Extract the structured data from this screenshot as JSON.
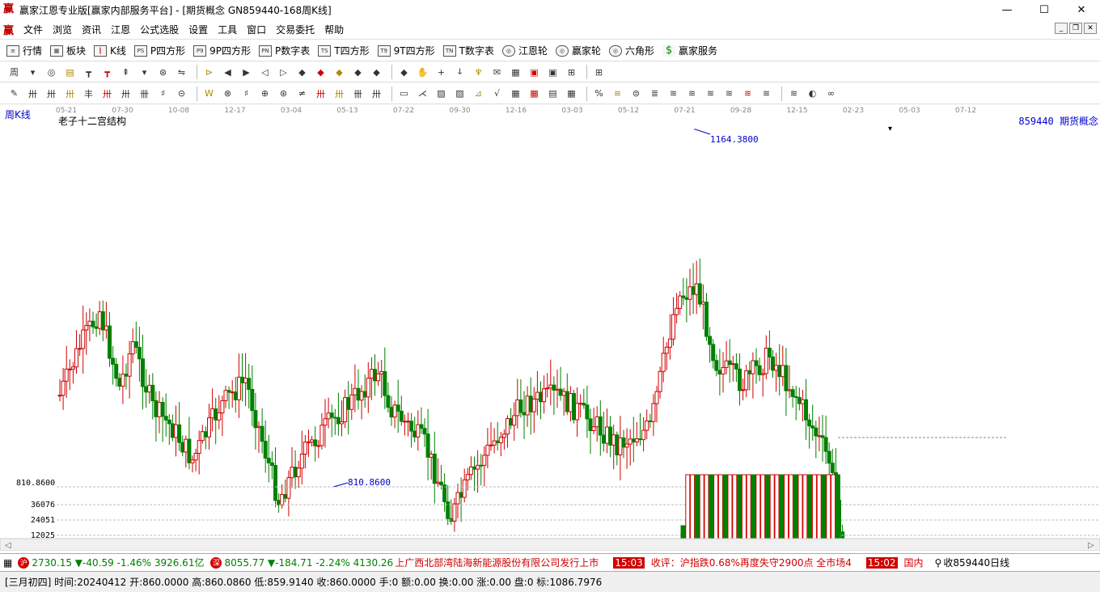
{
  "window": {
    "title": "赢家江恩专业版[赢家内部服务平台] - [期货概念  GN859440-168周K线]",
    "logo": "赢",
    "minimize": "—",
    "maximize": "☐",
    "close": "✕"
  },
  "menu": {
    "logo": "赢",
    "items": [
      "文件",
      "浏览",
      "资讯",
      "江恩",
      "公式选股",
      "设置",
      "工具",
      "窗口",
      "交易委托",
      "帮助"
    ]
  },
  "mdi": {
    "min": "_",
    "restore": "❐",
    "close": "✕"
  },
  "toolbar1": {
    "items": [
      {
        "icon": "≡",
        "label": "行情"
      },
      {
        "icon": "▦",
        "label": "板块"
      },
      {
        "icon": "┃",
        "label": "K线"
      },
      {
        "icon": "PS",
        "label": "P四方形"
      },
      {
        "icon": "P9",
        "label": "9P四方形"
      },
      {
        "icon": "PN",
        "label": "P数字表"
      },
      {
        "icon": "TS",
        "label": "T四方形"
      },
      {
        "icon": "T9",
        "label": "9T四方形"
      },
      {
        "icon": "TN",
        "label": "T数字表"
      },
      {
        "icon": "◎",
        "label": "江恩轮"
      },
      {
        "icon": "◎",
        "label": "赢家轮"
      },
      {
        "icon": "◎",
        "label": "六角形"
      },
      {
        "icon": "$",
        "label": "赢家服务"
      }
    ]
  },
  "toolbar2_icons": [
    "周",
    "▾",
    "◎",
    "▤",
    "┳",
    "┳",
    "⇞",
    "▾",
    "⊛",
    "⇋",
    "⊳",
    "◀",
    "▶",
    "◁",
    "▷",
    "◆",
    "◆",
    "◆",
    "◆",
    "◆",
    "◆",
    "✋",
    "+",
    "ↆ",
    "♆",
    "✉",
    "▦",
    "▣",
    "▣",
    "⊞",
    "⊞"
  ],
  "toolbar3_icons": [
    "✎",
    "卅",
    "卅",
    "卅",
    "丰",
    "卅",
    "卅",
    "卌",
    "♯",
    "⊝",
    "W",
    "⊗",
    "♯",
    "⊕",
    "⊛",
    "≠",
    "卅",
    "卅",
    "卌",
    "卅",
    "▭",
    "⋌",
    "▨",
    "▨",
    "⊿",
    "√",
    "▦",
    "▦",
    "▤",
    "▦",
    "%",
    "≡",
    "⊜",
    "≣",
    "≋",
    "≋",
    "≋",
    "≋",
    "≋",
    "≋",
    "≋",
    "◐",
    "∞"
  ],
  "chart": {
    "period_label": "周K线",
    "indicator_name": "老子十二宫结构",
    "symbol_label": "859440 期货概念",
    "date_ticks": [
      "05-21",
      "07-30",
      "10-08",
      "12-17",
      "03-04",
      "05-13",
      "07-22",
      "09-30",
      "12-16",
      "03-03",
      "05-12",
      "07-21",
      "09-28",
      "12-15",
      "02-23",
      "05-03",
      "07-12"
    ],
    "high_label": "1164.3800",
    "low_label": "810.8600",
    "price_axis_label": "810.8600",
    "vol_ticks": [
      "36076",
      "24051",
      "12025"
    ],
    "scroll_left": "◁",
    "scroll_right": "▷",
    "dropdown": "▾"
  },
  "chart_data": {
    "type": "candlestick",
    "title": "老子十二宫结构",
    "high": 1164.38,
    "low": 810.86,
    "last_close": 860.0,
    "x_ticks": [
      "05-21",
      "07-30",
      "10-08",
      "12-17",
      "03-04",
      "05-13",
      "07-22",
      "09-30",
      "12-16",
      "03-03",
      "05-12",
      "07-21",
      "09-28",
      "12-15",
      "02-23",
      "05-03",
      "07-12"
    ],
    "volume_ticks": [
      36076,
      24051,
      12025
    ]
  },
  "status1": {
    "sh_icon": "沪",
    "sh_index": "2730.15",
    "sh_change": "▼-40.59",
    "sh_pct": "-1.46%",
    "sh_amount": "3926.61亿",
    "sz_icon": "深",
    "sz_index": "8055.77",
    "sz_change": "▼-184.71",
    "sz_pct": "-2.24%",
    "sz_amount": "4130.26",
    "news1": "上广西北部湾陆海新能源股份有限公司发行上市",
    "time1": "15:03",
    "news2": "收评：沪指跌0.68%再度失守2900点 全市场4",
    "time2": "15:02",
    "region": "国内",
    "right_label": "收859440日线"
  },
  "status2": {
    "text": "[三月初四] 时间:20240412 开:860.0000 高:860.0860 低:859.9140 收:860.0000 手:0 额:0.00 换:0.00 涨:0.00 盘:0 标:1086.7976"
  }
}
